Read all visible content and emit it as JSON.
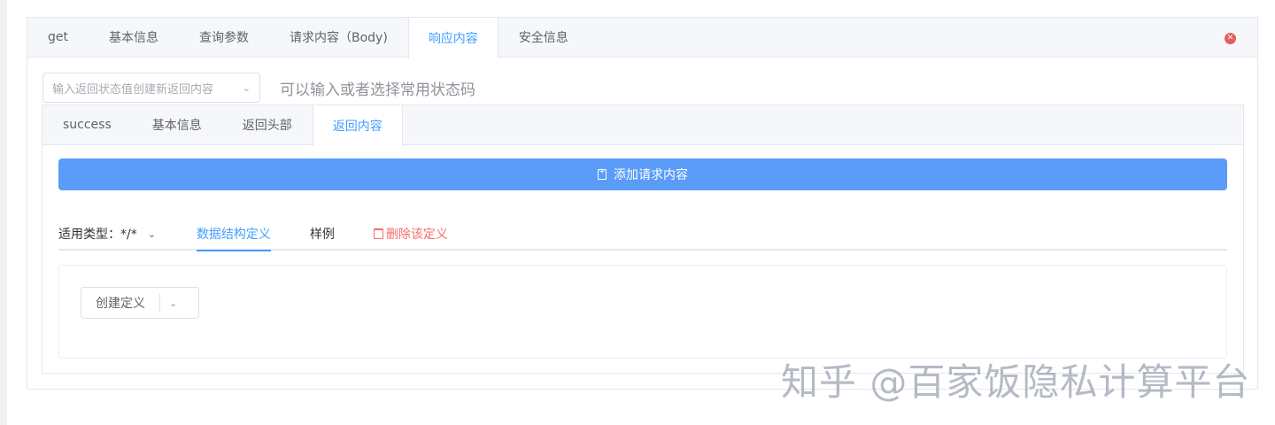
{
  "outer_tabs": [
    "get",
    "基本信息",
    "查询参数",
    "请求内容（Body)",
    "响应内容",
    "安全信息"
  ],
  "outer_active_tab": "响应内容",
  "close_glyph": "✕",
  "status": {
    "placeholder": "输入返回状态值创建新返回内容",
    "hint": "可以输入或者选择常用状态码"
  },
  "inner_tabs": [
    "success",
    "基本信息",
    "返回头部",
    "返回内容"
  ],
  "inner_active_tab": "返回内容",
  "add_button_label": "添加请求内容",
  "definition": {
    "type_label": "适用类型：*/*",
    "tabs": [
      "数据结构定义",
      "样例"
    ],
    "delete_label": "删除该定义"
  },
  "create_def_label": "创建定义",
  "watermark": "知乎 @百家饭隐私计算平台",
  "colors": {
    "accent": "#409eff",
    "button": "#5a9cf8",
    "danger": "#f56c6c"
  }
}
